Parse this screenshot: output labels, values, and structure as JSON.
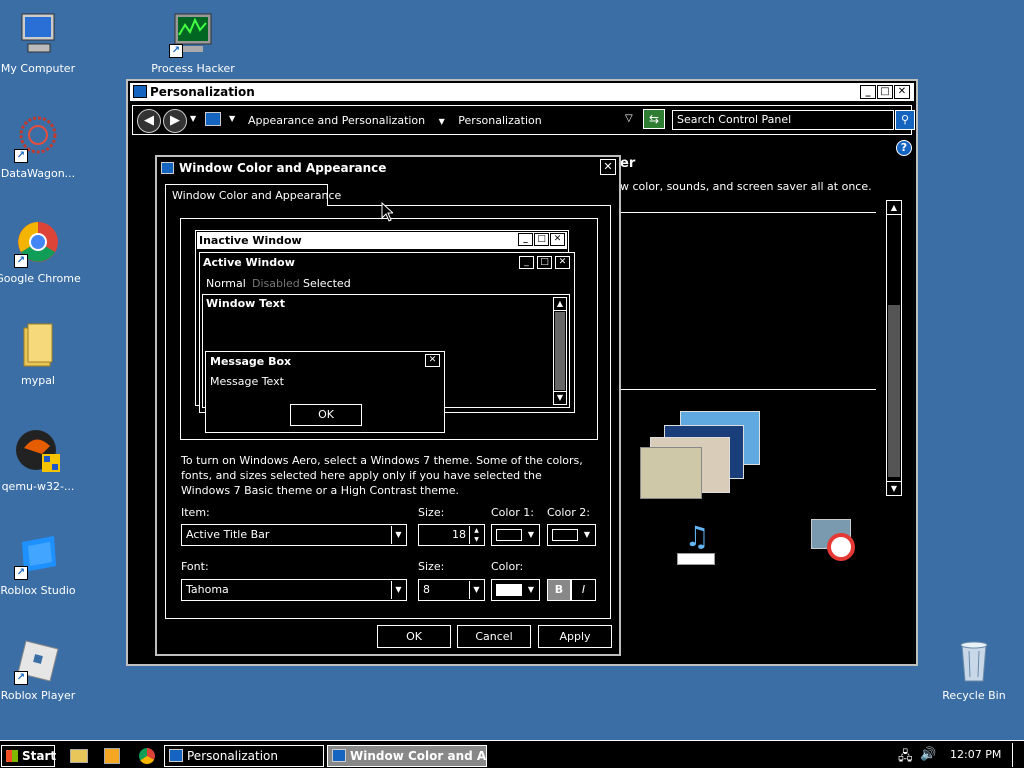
{
  "desktop": {
    "icons": [
      {
        "label": "My Computer",
        "icon": "computer-icon"
      },
      {
        "label": "Process Hacker",
        "icon": "monitor-graph-icon"
      },
      {
        "label": "DataWagon...",
        "icon": "datawagon-icon"
      },
      {
        "label": "Google Chrome",
        "icon": "chrome-icon"
      },
      {
        "label": "mypal",
        "icon": "folder-icon"
      },
      {
        "label": "qemu-w32-...",
        "icon": "qemu-icon"
      },
      {
        "label": "Roblox Studio",
        "icon": "roblox-studio-icon"
      },
      {
        "label": "Roblox Player",
        "icon": "roblox-player-icon"
      },
      {
        "label": "Recycle Bin",
        "icon": "recycle-bin-icon"
      }
    ]
  },
  "personalization_window": {
    "title": "Personalization",
    "breadcrumb": [
      "Appearance and Personalization",
      "Personalization"
    ],
    "search_placeholder": "Search Control Panel",
    "heading_fragment": "er",
    "desc_fragment": "w color, sounds, and screen saver all at once."
  },
  "dialog": {
    "title": "Window Color and Appearance",
    "tab": "Window Color and Appearance",
    "preview": {
      "inactive_title": "Inactive Window",
      "active_title": "Active Window",
      "menu": [
        "Normal",
        "Disabled",
        "Selected"
      ],
      "window_text": "Window Text",
      "msgbox_title": "Message Box",
      "msgbox_text": "Message Text",
      "msgbox_ok": "OK"
    },
    "info_text": "To turn on Windows Aero, select a Windows 7 theme.  Some of the colors, fonts, and sizes selected here apply only if you have selected the Windows 7 Basic theme or a High Contrast theme.",
    "item_label": "Item:",
    "item_value": "Active Title Bar",
    "size_label": "Size:",
    "size_value": "18",
    "color1_label": "Color 1:",
    "color2_label": "Color 2:",
    "font_label": "Font:",
    "font_value": "Tahoma",
    "font_size_label": "Size:",
    "font_size_value": "8",
    "font_color_label": "Color:",
    "bold": "B",
    "italic": "I",
    "ok": "OK",
    "cancel": "Cancel",
    "apply": "Apply"
  },
  "taskbar": {
    "start": "Start",
    "tasks": [
      "Personalization",
      "Window Color and Ap..."
    ],
    "clock": "12:07 PM"
  }
}
